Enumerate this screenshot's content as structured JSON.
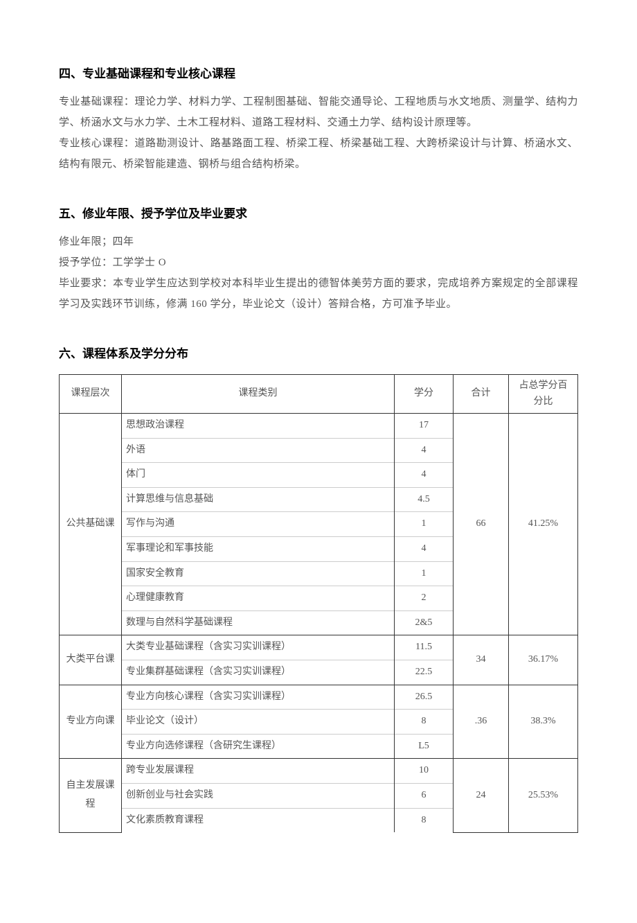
{
  "section4": {
    "heading": "四、专业基础课程和专业核心课程",
    "p1": "专业基础课程：理论力学、材料力学、工程制图基础、智能交通导论、工程地质与水文地质、测量学、结构力学、桥涵水文与水力学、土木工程材料、道路工程材料、交通土力学、结构设计原理等。",
    "p2": "专业核心课程：道路勘测设计、路基路面工程、桥梁工程、桥梁基础工程、大跨桥梁设计与计算、桥涵水文、结构有限元、桥梁智能建造、钢桥与组合结构桥梁。"
  },
  "section5": {
    "heading": "五、修业年限、授予学位及毕业要求",
    "p1": "修业年限；四年",
    "p2": "授予学位：工学学士 O",
    "p3": "毕业要求：本专业学生应达到学校对本科毕业生提出的德智体美劳方面的要求，完成培养方案规定的全部课程学习及实践环节训练，修满 160 学分，毕业论文（设计）答辩合格，方可准予毕业。"
  },
  "section6": {
    "heading": "六、课程体系及学分分布",
    "table": {
      "headers": {
        "level": "课程层次",
        "category": "课程类别",
        "credit": "学分",
        "total": "合计",
        "percent": "占总学分百分比"
      },
      "groups": [
        {
          "level": "公共基础课",
          "total": "66",
          "percent": "41.25%",
          "rows": [
            {
              "cat": "思想政治课程",
              "credit": "17"
            },
            {
              "cat": "外语",
              "credit": "4"
            },
            {
              "cat": "体门",
              "credit": "4"
            },
            {
              "cat": "计算思维与信息基础",
              "credit": "4.5"
            },
            {
              "cat": "写作与沟通",
              "credit": "1"
            },
            {
              "cat": "军事理论和军事技能",
              "credit": "4"
            },
            {
              "cat": "国家安全教育",
              "credit": "1"
            },
            {
              "cat": "心理健康教育",
              "credit": "2"
            },
            {
              "cat": "数理与自然科学基础课程",
              "credit": "2&5"
            }
          ]
        },
        {
          "level": "大类平台课",
          "total": "34",
          "percent": "36.17%",
          "rows": [
            {
              "cat": "大类专业基础课程（含实习实训课程）",
              "credit": "11.5"
            },
            {
              "cat": "专业集群基础课程（含实习实训课程）",
              "credit": "22.5"
            }
          ]
        },
        {
          "level": "专业方向课",
          "total": ".36",
          "percent": "38.3%",
          "rows": [
            {
              "cat": "专业方向核心课程（含实习实训课程）",
              "credit": "26.5"
            },
            {
              "cat": "毕业论文（设计）",
              "credit": "8"
            },
            {
              "cat": "专业方向选修课程（含研究生课程）",
              "credit": "L5"
            }
          ]
        },
        {
          "level": "自主发展课程",
          "total": "24",
          "percent": "25.53%",
          "rows": [
            {
              "cat": "跨专业发展课程",
              "credit": "10"
            },
            {
              "cat": "创新创业与社会实践",
              "credit": "6"
            },
            {
              "cat": "文化素质教育课程",
              "credit": "8"
            }
          ]
        }
      ]
    }
  }
}
